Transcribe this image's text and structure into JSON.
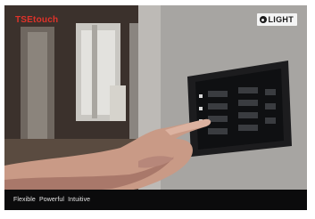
{
  "header": {
    "product": "TSEtouch",
    "logo_text": "LIGHT",
    "logo_icon": "circle-o-icon"
  },
  "footer": {
    "tagline": "Flexible  Powerful  Intuitive"
  },
  "colors": {
    "brand_red": "#e0322a",
    "footer_bg": "#0b0b0c"
  }
}
